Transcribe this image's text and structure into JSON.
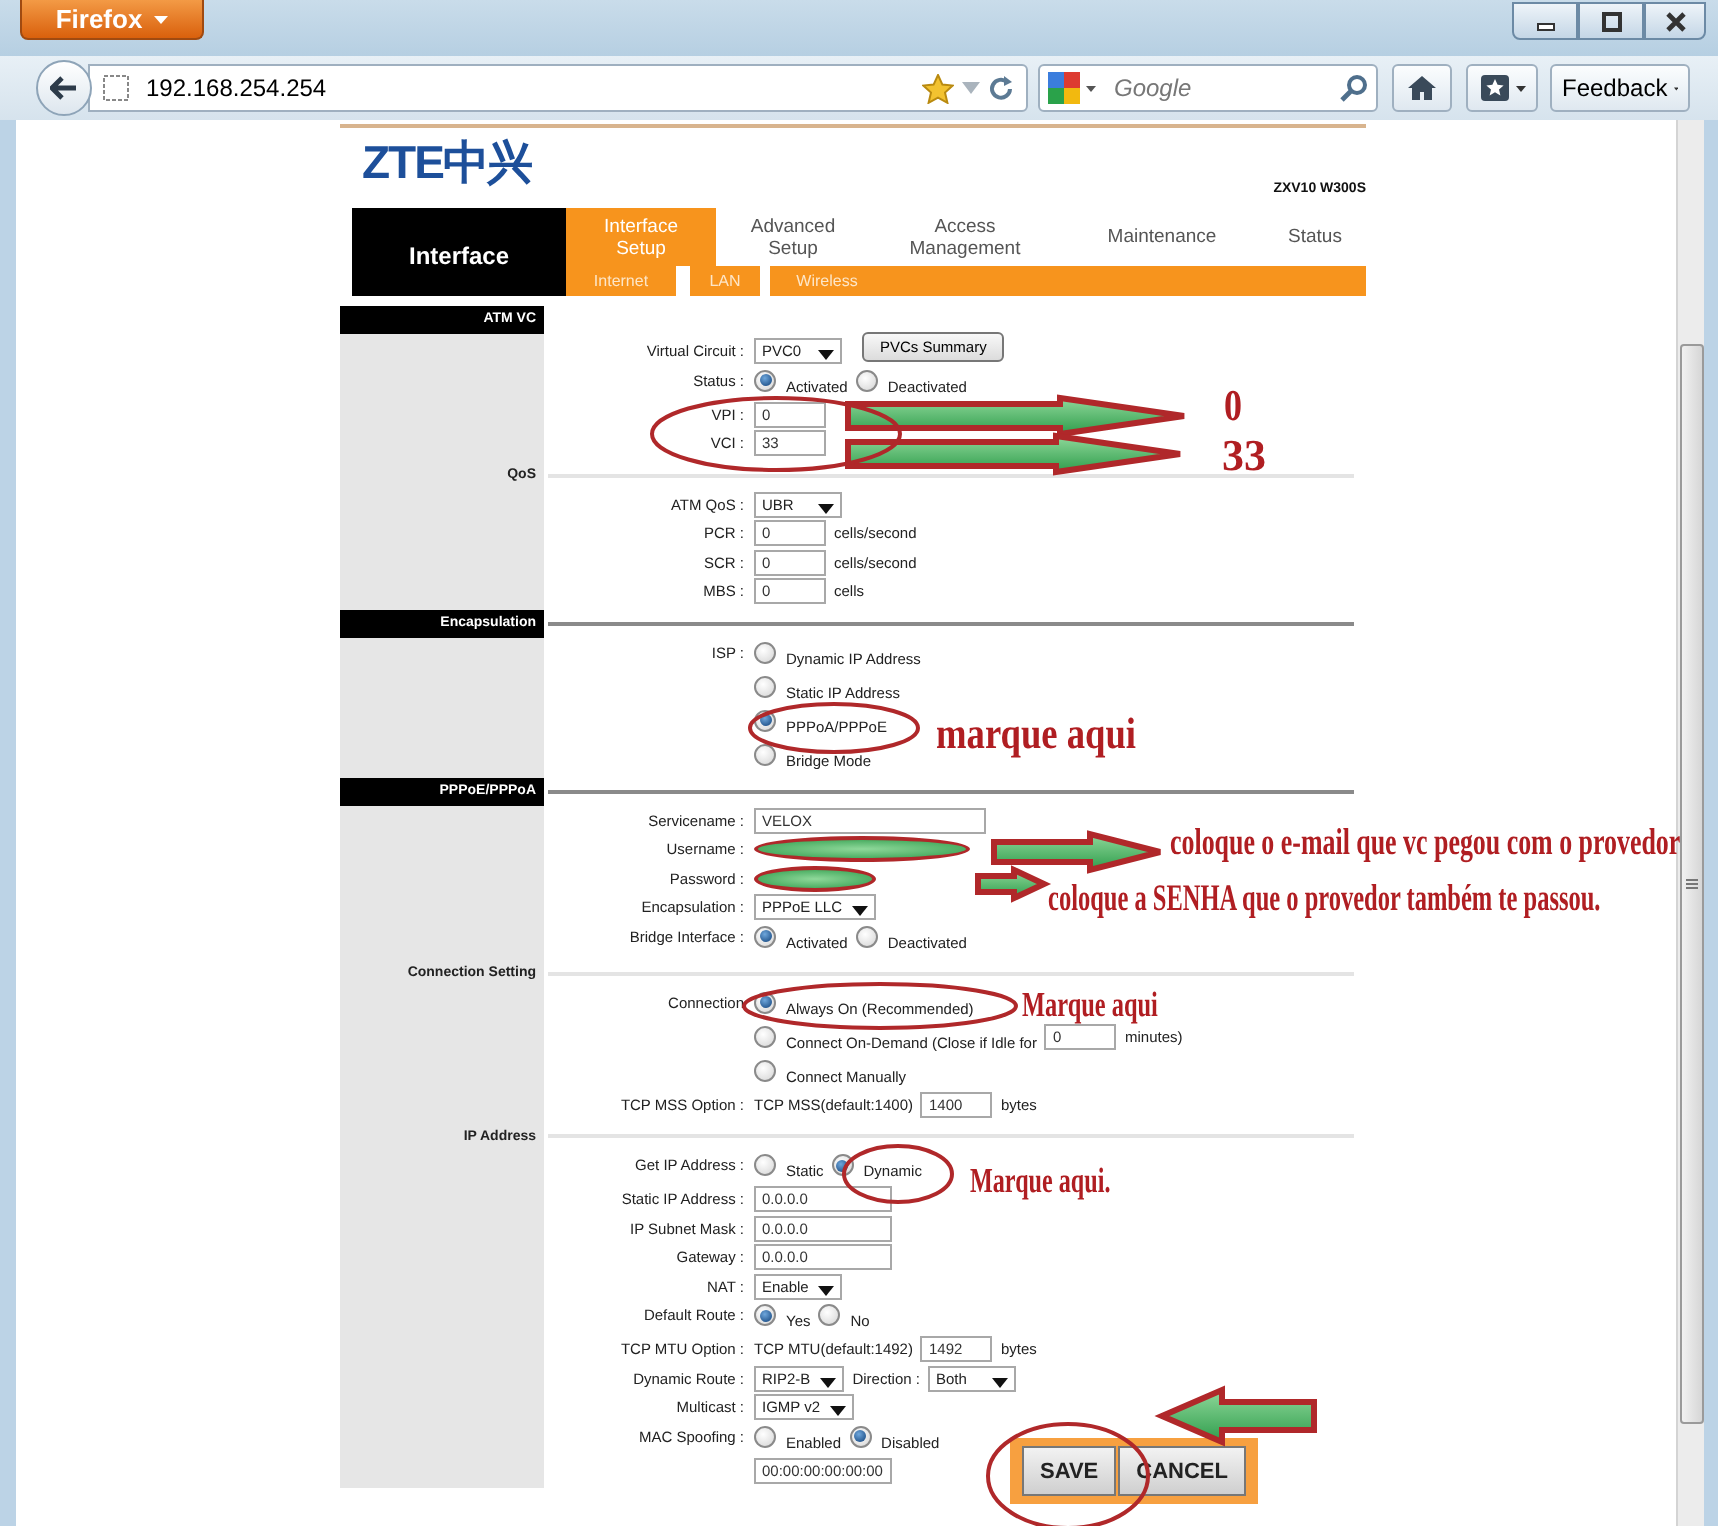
{
  "browser": {
    "menu_button": "Firefox",
    "url": "192.168.254.254",
    "search": {
      "placeholder": "Google"
    },
    "feedback_button": "Feedback"
  },
  "router": {
    "logo": "ZTE中兴",
    "model": "ZXV10 W300S",
    "area_title": "Interface",
    "tabs": [
      {
        "label": "Interface Setup",
        "selected": true
      },
      {
        "label": "Advanced Setup",
        "selected": false
      },
      {
        "label": "Access Management",
        "selected": false
      },
      {
        "label": "Maintenance",
        "selected": false
      },
      {
        "label": "Status",
        "selected": false
      }
    ],
    "subtabs": [
      {
        "label": "Internet"
      },
      {
        "label": "LAN"
      },
      {
        "label": "Wireless"
      }
    ],
    "sections": [
      {
        "title": "ATM VC",
        "kind": "header",
        "rows": [
          {
            "label": "Virtual Circuit :",
            "controls": [
              {
                "kind": "select",
                "value": "PVC0"
              },
              {
                "kind": "button",
                "label": "PVCs Summary"
              }
            ]
          },
          {
            "label": "Status :",
            "controls": [
              {
                "kind": "radio",
                "label": "Activated",
                "selected": true
              },
              {
                "kind": "radio",
                "label": "Deactivated",
                "selected": false
              }
            ]
          },
          {
            "label": "VPI :",
            "controls": [
              {
                "kind": "input",
                "value": "0"
              }
            ]
          },
          {
            "label": "VCI :",
            "controls": [
              {
                "kind": "input",
                "value": "33"
              }
            ]
          }
        ]
      },
      {
        "title": "QoS",
        "kind": "plain",
        "rows": [
          {
            "label": "ATM QoS :",
            "controls": [
              {
                "kind": "select",
                "value": "UBR"
              }
            ]
          },
          {
            "label": "PCR :",
            "controls": [
              {
                "kind": "input",
                "value": "0"
              },
              {
                "kind": "text",
                "text": "cells/second"
              }
            ]
          },
          {
            "label": "SCR :",
            "controls": [
              {
                "kind": "input",
                "value": "0"
              },
              {
                "kind": "text",
                "text": "cells/second"
              }
            ]
          },
          {
            "label": "MBS :",
            "controls": [
              {
                "kind": "input",
                "value": "0"
              },
              {
                "kind": "text",
                "text": "cells"
              }
            ]
          }
        ]
      },
      {
        "title": "Encapsulation",
        "kind": "header",
        "rows": [
          {
            "label": "ISP :",
            "controls": [
              {
                "kind": "radio",
                "label": "Dynamic IP Address",
                "selected": false
              }
            ]
          },
          {
            "controls": [
              {
                "kind": "radio",
                "label": "Static IP Address",
                "selected": false
              }
            ]
          },
          {
            "controls": [
              {
                "kind": "radio",
                "label": "PPPoA/PPPoE",
                "selected": true
              }
            ]
          },
          {
            "controls": [
              {
                "kind": "radio",
                "label": "Bridge Mode",
                "selected": false
              }
            ]
          }
        ]
      },
      {
        "title": "PPPoE/PPPoA",
        "kind": "header",
        "rows": [
          {
            "label": "Servicename :",
            "controls": [
              {
                "kind": "wideinput",
                "value": "VELOX"
              }
            ]
          },
          {
            "label": "Username :",
            "controls": [
              {
                "kind": "wideinput"
              }
            ]
          },
          {
            "label": "Password :",
            "controls": [
              {
                "kind": "midinput"
              }
            ]
          },
          {
            "label": "Encapsulation :",
            "controls": [
              {
                "kind": "select",
                "value": "PPPoE LLC"
              }
            ]
          },
          {
            "label": "Bridge Interface :",
            "controls": [
              {
                "kind": "radio",
                "label": "Activated",
                "selected": true
              },
              {
                "kind": "radio",
                "label": "Deactivated",
                "selected": false
              }
            ]
          }
        ]
      },
      {
        "title": "Connection Setting",
        "kind": "plain",
        "rows": [
          {
            "label": "Connection",
            "controls": [
              {
                "kind": "radio",
                "label": "Always On (Recommended)",
                "selected": true
              }
            ]
          },
          {
            "controls": [
              {
                "kind": "radio",
                "label": "Connect On-Demand (Close if Idle for",
                "selected": false
              },
              {
                "kind": "input",
                "value": "0"
              },
              {
                "kind": "text",
                "text": "minutes)"
              }
            ]
          },
          {
            "controls": [
              {
                "kind": "radio",
                "label": "Connect Manually",
                "selected": false
              }
            ]
          },
          {
            "label": "TCP MSS Option :",
            "controls": [
              {
                "kind": "text",
                "text": "TCP MSS(default:1400)"
              },
              {
                "kind": "input",
                "value": "1400"
              },
              {
                "kind": "text",
                "text": "bytes"
              }
            ]
          }
        ]
      },
      {
        "title": "IP Address",
        "kind": "plain",
        "rows": [
          {
            "label": "Get IP Address :",
            "controls": [
              {
                "kind": "radio",
                "label": "Static",
                "selected": false
              },
              {
                "kind": "radio",
                "label": "Dynamic",
                "selected": true
              }
            ]
          },
          {
            "label": "Static IP Address :",
            "controls": [
              {
                "kind": "midinput",
                "value": "0.0.0.0"
              }
            ]
          },
          {
            "label": "IP Subnet Mask :",
            "controls": [
              {
                "kind": "midinput",
                "value": "0.0.0.0"
              }
            ]
          },
          {
            "label": "Gateway :",
            "controls": [
              {
                "kind": "midinput",
                "value": "0.0.0.0"
              }
            ]
          },
          {
            "label": "NAT :",
            "controls": [
              {
                "kind": "select",
                "value": "Enable"
              }
            ]
          },
          {
            "label": "Default Route :",
            "controls": [
              {
                "kind": "radio",
                "label": "Yes",
                "selected": true
              },
              {
                "kind": "radio",
                "label": "No",
                "selected": false
              }
            ]
          },
          {
            "label": "TCP MTU Option :",
            "controls": [
              {
                "kind": "text",
                "text": "TCP MTU(default:1492)"
              },
              {
                "kind": "input",
                "value": "1492"
              },
              {
                "kind": "text",
                "text": "bytes"
              }
            ]
          },
          {
            "label": "Dynamic Route :",
            "controls": [
              {
                "kind": "select",
                "value": "RIP2-B"
              },
              {
                "kind": "text",
                "text": "Direction :"
              },
              {
                "kind": "select",
                "value": "Both"
              }
            ]
          },
          {
            "label": "Multicast :",
            "controls": [
              {
                "kind": "select",
                "value": "IGMP v2"
              }
            ]
          },
          {
            "label": "MAC Spoofing :",
            "controls": [
              {
                "kind": "radio",
                "label": "Enabled",
                "selected": false
              },
              {
                "kind": "radio",
                "label": "Disabled",
                "selected": true
              }
            ]
          },
          {
            "controls": [
              {
                "kind": "midinput",
                "value": "00:00:00:00:00:00"
              }
            ]
          }
        ]
      }
    ],
    "actions": [
      "SAVE",
      "CANCEL"
    ]
  },
  "annotations": [
    {
      "text": "0"
    },
    {
      "text": "33"
    },
    {
      "text": "marque aqui"
    },
    {
      "text": "coloque o e-mail que vc pegou com o provedor"
    },
    {
      "text": "coloque a SENHA que o provedor também te passou."
    },
    {
      "text": "Marque aqui"
    },
    {
      "text": "Marque aqui."
    }
  ]
}
